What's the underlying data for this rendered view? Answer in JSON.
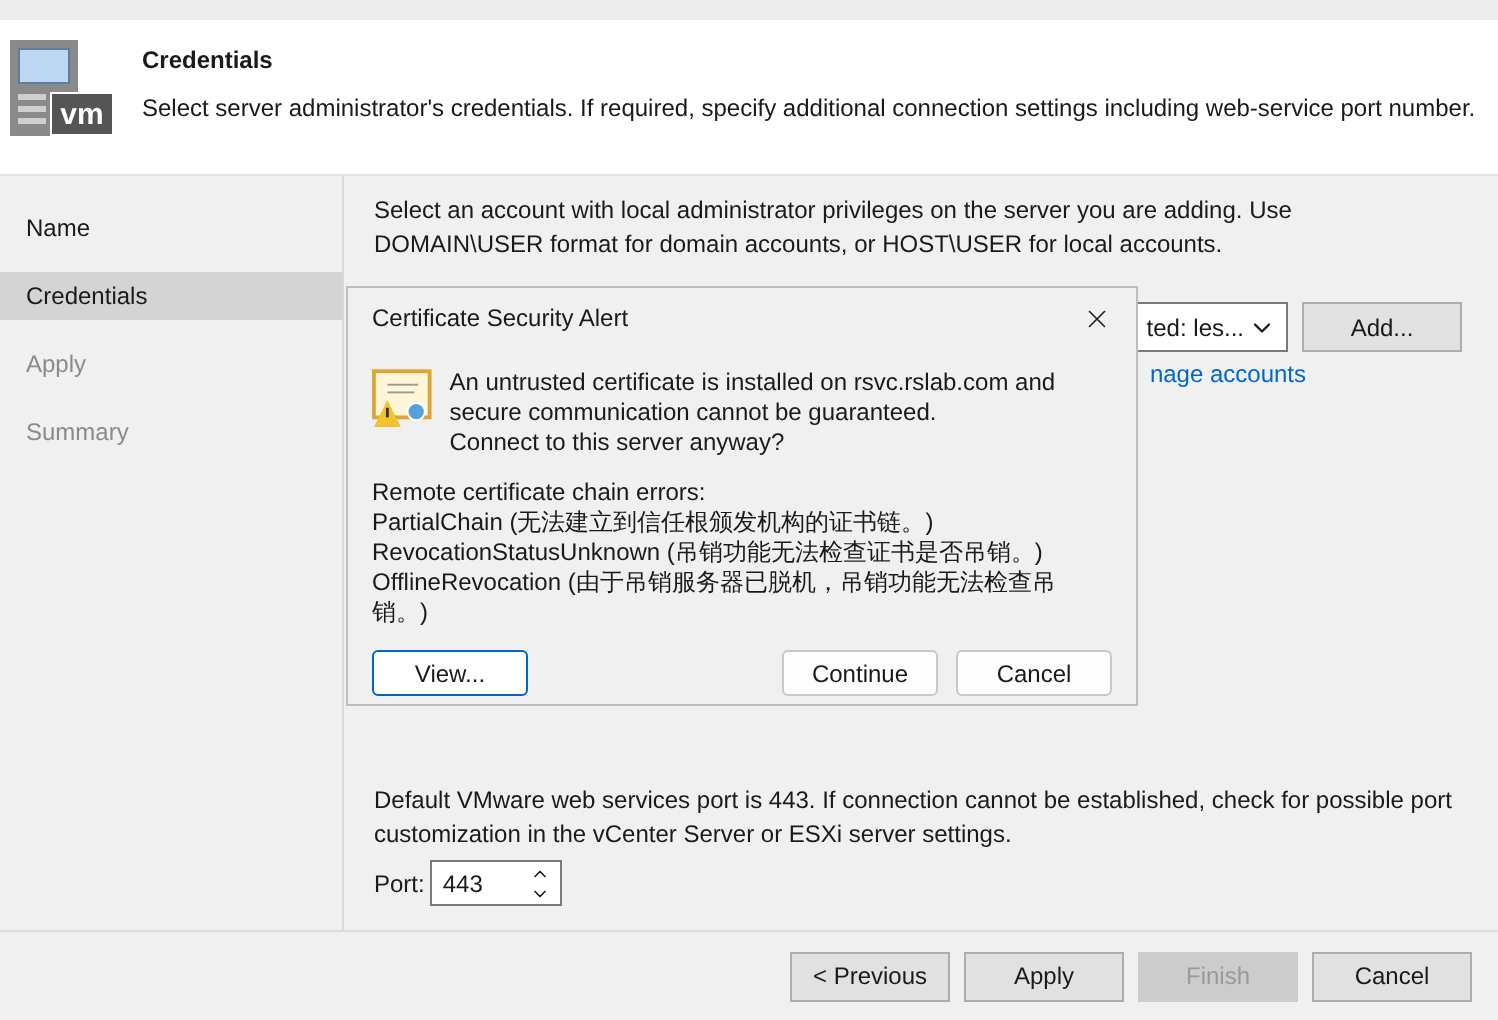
{
  "wizard_header": {
    "logo_text": "vm",
    "title": "Credentials",
    "description": "Select server administrator's credentials. If required, specify additional connection settings including web-service port number."
  },
  "steps": [
    {
      "label": "Name",
      "selected": false,
      "disabled": false
    },
    {
      "label": "Credentials",
      "selected": true,
      "disabled": false
    },
    {
      "label": "Apply",
      "selected": false,
      "disabled": true
    },
    {
      "label": "Summary",
      "selected": false,
      "disabled": true
    }
  ],
  "credentials": {
    "instructions": "Select an account with local administrator privileges on the server you are adding. Use DOMAIN\\USER format for domain accounts, or HOST\\USER for local accounts.",
    "account_dropdown": {
      "value": "ted: les..."
    },
    "add_button": "Add...",
    "manage_link": "nage accounts"
  },
  "port_section": {
    "note": "Default VMware web services port is 443. If connection cannot be established, check for possible port customization in the vCenter Server or ESXi server settings.",
    "port_label": "Port:",
    "port_value": "443"
  },
  "footer_buttons": [
    {
      "label": "< Previous",
      "disabled": false
    },
    {
      "label": "Apply",
      "disabled": false
    },
    {
      "label": "Finish",
      "disabled": true
    },
    {
      "label": "Cancel",
      "disabled": false
    }
  ],
  "dialog": {
    "title": "Certificate Security Alert",
    "message": "An untrusted certificate is installed on rsvc.rslab.com and secure communication cannot be guaranteed.",
    "question": "Connect to this server anyway?",
    "errors_heading": "Remote certificate chain errors:",
    "errors": [
      "PartialChain (无法建立到信任根颁发机构的证书链。)",
      "RevocationStatusUnknown (吊销功能无法检查证书是否吊销。)",
      "OfflineRevocation (由于吊销服务器已脱机，吊销功能无法检查吊销。)"
    ],
    "buttons": [
      {
        "label": "View...",
        "default": true
      },
      {
        "label": "Continue",
        "default": false
      },
      {
        "label": "Cancel",
        "default": false
      }
    ]
  }
}
